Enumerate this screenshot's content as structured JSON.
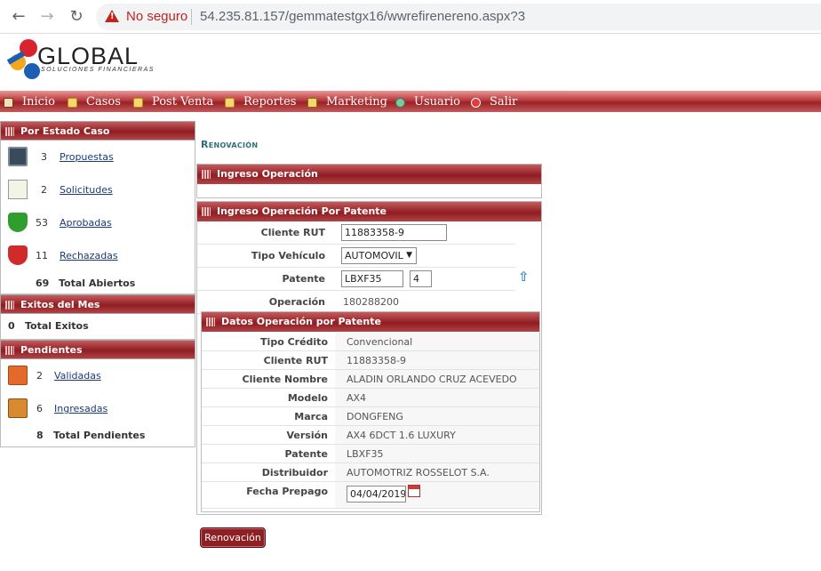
{
  "browser": {
    "back_icon": "arrow-left-icon",
    "forward_icon": "arrow-right-icon",
    "reload_icon": "reload-icon",
    "security_label": "No seguro",
    "url": "54.235.81.157/gemmatestgx16/wwrefirenereno.aspx?3"
  },
  "logo": {
    "name": "GLOBAL",
    "tagline": "SOLUCIONES FINANCIERAS"
  },
  "menu": {
    "items": [
      {
        "label": "Inicio",
        "icon": "home-icon"
      },
      {
        "label": "Casos",
        "icon": "folder-icon"
      },
      {
        "label": "Post Venta",
        "icon": "folder-icon"
      },
      {
        "label": "Reportes",
        "icon": "folder-icon"
      },
      {
        "label": "Marketing",
        "icon": "marketing-icon"
      },
      {
        "label": "Usuario",
        "icon": "user-icon"
      },
      {
        "label": "Salir",
        "icon": "exit-icon"
      }
    ]
  },
  "sidebar": {
    "estado": {
      "title": "Por Estado Caso",
      "rows": [
        {
          "count": "3",
          "label": "Propuestas",
          "icon": "calculator-icon"
        },
        {
          "count": "2",
          "label": "Solicitudes",
          "icon": "document-icon"
        },
        {
          "count": "53",
          "label": "Aprobadas",
          "icon": "shield-check-icon"
        },
        {
          "count": "11",
          "label": "Rechazadas",
          "icon": "shield-x-icon"
        }
      ],
      "total_count": "69",
      "total_label": "Total Abiertos"
    },
    "exitos": {
      "title": "Exitos del Mes",
      "total_count": "0",
      "total_label": "Total Exitos"
    },
    "pendientes": {
      "title": "Pendientes",
      "rows": [
        {
          "count": "2",
          "label": "Validadas",
          "icon": "folder-validated-icon"
        },
        {
          "count": "6",
          "label": "Ingresadas",
          "icon": "folder-entered-icon"
        }
      ],
      "total_count": "8",
      "total_label": "Total Pendientes"
    }
  },
  "main": {
    "title": "Renovación",
    "panel1_title": "Ingreso Operación",
    "panel2_title": "Ingreso Operación Por Patente",
    "form": {
      "cliente_rut_label": "Cliente RUT",
      "cliente_rut_value": "11883358-9",
      "tipo_vehiculo_label": "Tipo Vehículo",
      "tipo_vehiculo_value": "AUTOMOVIL",
      "patente_label": "Patente",
      "patente_value": "LBXF35",
      "patente_digit": "4",
      "operacion_label": "Operación",
      "operacion_value": "180288200"
    },
    "details_title": "Datos Operación por Patente",
    "details": [
      {
        "label": "Tipo Crédito",
        "value": "Convencional"
      },
      {
        "label": "Cliente RUT",
        "value": "11883358-9"
      },
      {
        "label": "Cliente Nombre",
        "value": "ALADIN ORLANDO CRUZ ACEVEDO"
      },
      {
        "label": "Modelo",
        "value": "AX4"
      },
      {
        "label": "Marca",
        "value": "DONGFENG"
      },
      {
        "label": "Versión",
        "value": "AX4 6DCT 1.6 LUXURY"
      },
      {
        "label": "Patente",
        "value": "LBXF35"
      },
      {
        "label": "Distribuidor",
        "value": "AUTOMOTRIZ ROSSELOT S.A."
      }
    ],
    "fecha_prepago_label": "Fecha Prepago",
    "fecha_prepago_value": "04/04/2019",
    "button_label": "Renovación"
  }
}
